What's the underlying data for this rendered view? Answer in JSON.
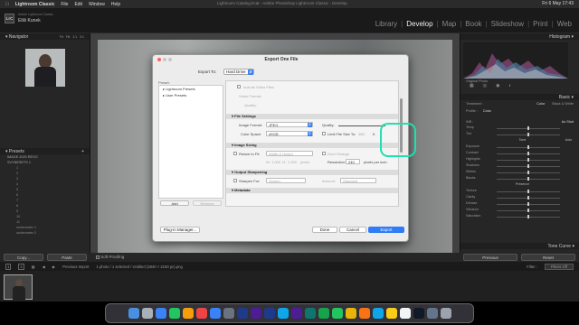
{
  "menubar": {
    "items": [
      "Lightroom Classic",
      "File",
      "Edit",
      "Window",
      "Help"
    ],
    "window_title": "Lightroom Catalog.lrcat - Adobe Photoshop Lightroom Classic - Develop",
    "clock": "Fri 6 May 17:43"
  },
  "header": {
    "badge": "LrC",
    "subtitle": "Adobe Lightroom Classic",
    "user": "Eliši Kunek",
    "modules": [
      "Library",
      "Develop",
      "Map",
      "Book",
      "Slideshow",
      "Print",
      "Web"
    ],
    "active_module": "Develop"
  },
  "left_panel": {
    "navigator_title": "Navigator",
    "nav_zoom": [
      "Fit",
      "Fill",
      "1:1",
      "3:1"
    ],
    "presets_title": "Presets",
    "preset_groups": [
      "IMAGE 2020 REVO",
      "SVYNESETS 1"
    ],
    "preset_rows": [
      "1",
      "2",
      "3",
      "4",
      "5",
      "6",
      "7",
      "8",
      "9",
      "10",
      "11",
      "underwater 1",
      "underwater 2"
    ],
    "copy_label": "Copy...",
    "paste_label": "Paste"
  },
  "right_panel": {
    "histogram_title": "Histogram",
    "original_photo": "Original Photo",
    "basic_title": "Basic",
    "treatment_label": "Treatment :",
    "treatment_options": [
      "Color",
      "Black & White"
    ],
    "profile_label": "Profile :",
    "wb_label": "WB :",
    "wb_value": "As Shot",
    "tone_label": "Tone",
    "tone_auto": "Auto",
    "sliders": [
      "Temp",
      "Tint",
      "Exposure",
      "Contrast",
      "Highlights",
      "Shadows",
      "Whites",
      "Blacks"
    ],
    "presence_label": "Presence",
    "presence_sliders": [
      "Texture",
      "Clarity",
      "Dehaze",
      "Vibrance",
      "Saturation"
    ],
    "tone_curve": "Tone Curve",
    "previous_label": "Previous",
    "reset_label": "Reset"
  },
  "toolbar": {
    "soft_proofing": "Soft Proofing"
  },
  "filmstrip": {
    "pages": [
      "1",
      "2"
    ],
    "previous_import": "Previous Import",
    "info": "1 photo / 1 selected / Untitled (3840 × 2160 px).png",
    "filter_label": "Filter :",
    "filter_value": "Filters Off"
  },
  "dialog": {
    "title": "Export One File",
    "export_to_label": "Export To:",
    "export_to_value": "Hard Drive",
    "preset_label": "Preset:",
    "settings_label": "Export One File",
    "presets": [
      "Lightroom Presets",
      "User Presets"
    ],
    "add_label": "Add",
    "remove_label": "Remove",
    "include_video": "Include Video Files",
    "video_format_label": "Video Format:",
    "quality_dim_label": "Quality:",
    "file_settings": "File Settings",
    "image_format_label": "Image Format:",
    "image_format_value": "JPEG",
    "quality_label": "Quality:",
    "color_space_label": "Color Space:",
    "color_space_value": "sRGB",
    "limit_size_label": "Limit File Size To:",
    "limit_size_value": "100",
    "limit_size_unit": "K",
    "image_sizing": "Image Sizing",
    "resize_label": "Resize to Fit:",
    "resize_value": "Width & Height",
    "dont_enlarge": "Don't Enlarge",
    "w_label": "W:",
    "w_value": "1.000",
    "h_label": "H:",
    "h_value": "1.000",
    "px_unit": "pixels",
    "resolution_label": "Resolution:",
    "resolution_value": "240",
    "resolution_unit": "pixels per inch",
    "output_sharpening": "Output Sharpening",
    "sharpen_for_label": "Sharpen For:",
    "sharpen_for_value": "Screen",
    "amount_label": "Amount:",
    "amount_value": "Standard",
    "metadata": "Metadata",
    "plugin_manager": "Plug-in Manager...",
    "done": "Done",
    "cancel": "Cancel",
    "export": "Export"
  },
  "dock": {
    "apps": [
      "Finder",
      "Launchpad",
      "Safari",
      "Messages",
      "Photos",
      "Music",
      "App Store",
      "Settings",
      "Ps",
      "Pr",
      "LrC",
      "Lr",
      "Ae",
      "Au",
      "Spotify",
      "WhatsApp",
      "Chrome",
      "VLC",
      "Telegram",
      "Notes",
      "Calendar",
      "Terminal",
      "Files",
      "Trash"
    ],
    "colors": [
      "#4a90e2",
      "#aab0b8",
      "#3b82f6",
      "#22c55e",
      "#f59e0b",
      "#ef4444",
      "#3b82f6",
      "#6b7280",
      "#1e3a8a",
      "#4c1d95",
      "#1e3a8a",
      "#0ea5e9",
      "#4c1d95",
      "#0f766e",
      "#16a34a",
      "#22c55e",
      "#eab308",
      "#f97316",
      "#0ea5e9",
      "#facc15",
      "#f3f4f6",
      "#111827",
      "#64748b",
      "#9ca3af"
    ]
  },
  "colors": {
    "highlight": "#1ee0b0",
    "export_button": "#2f7cf6"
  }
}
